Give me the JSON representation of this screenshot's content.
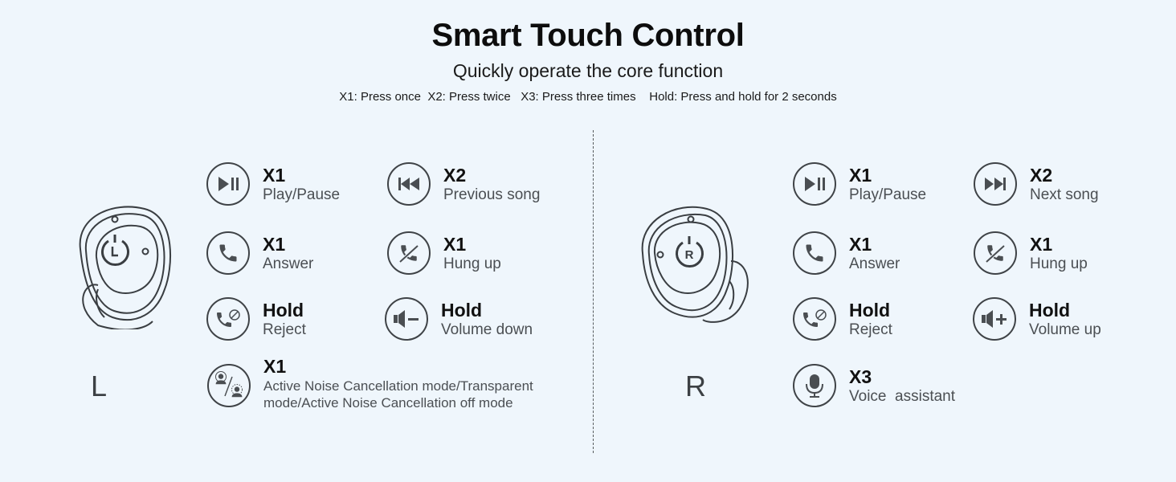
{
  "header": {
    "title": "Smart Touch Control",
    "subtitle": "Quickly operate the core function",
    "legend": "X1: Press once  X2: Press twice   X3: Press three times    Hold: Press and hold for 2 seconds"
  },
  "colors": {
    "background": "#eff6fc",
    "icon_stroke": "#3f4347",
    "action_text": "#111111",
    "description_text": "#4b4f53"
  },
  "left": {
    "label": "L",
    "earbud_letter": "L",
    "controls": [
      {
        "icon": "play-pause-icon",
        "action": "X1",
        "description": "Play/Pause"
      },
      {
        "icon": "previous-track-icon",
        "action": "X2",
        "description": "Previous song"
      },
      {
        "icon": "phone-answer-icon",
        "action": "X1",
        "description": "Answer"
      },
      {
        "icon": "phone-hangup-icon",
        "action": "X1",
        "description": "Hung up"
      },
      {
        "icon": "phone-reject-icon",
        "action": "Hold",
        "description": "Reject"
      },
      {
        "icon": "volume-down-icon",
        "action": "Hold",
        "description": "Volume down"
      },
      {
        "icon": "anc-mode-icon",
        "action": "X1",
        "description": "Active Noise Cancellation mode/Transparent mode/Active Noise Cancellation off mode"
      }
    ]
  },
  "right": {
    "label": "R",
    "earbud_letter": "R",
    "controls": [
      {
        "icon": "play-pause-icon",
        "action": "X1",
        "description": "Play/Pause"
      },
      {
        "icon": "next-track-icon",
        "action": "X2",
        "description": "Next song"
      },
      {
        "icon": "phone-answer-icon",
        "action": "X1",
        "description": "Answer"
      },
      {
        "icon": "phone-hangup-icon",
        "action": "X1",
        "description": "Hung up"
      },
      {
        "icon": "phone-reject-icon",
        "action": "Hold",
        "description": "Reject"
      },
      {
        "icon": "volume-up-icon",
        "action": "Hold",
        "description": "Volume up"
      },
      {
        "icon": "microphone-icon",
        "action": "X3",
        "description": "Voice  assistant"
      }
    ]
  }
}
